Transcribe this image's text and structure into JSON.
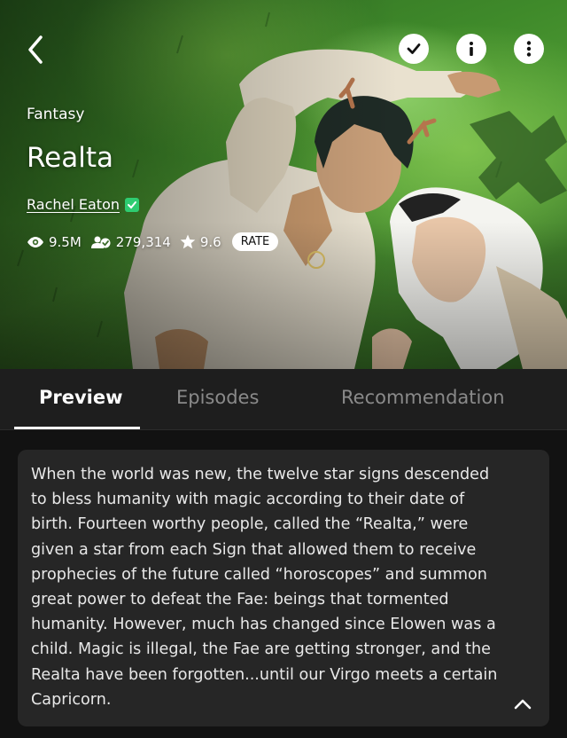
{
  "header": {
    "genre": "Fantasy",
    "title": "Realta",
    "author": "Rachel Eaton",
    "stats": {
      "views": "9.5M",
      "subscribers": "279,314",
      "rating": "9.6",
      "rate_label": "RATE"
    },
    "icons": {
      "back": "chevron-left-icon",
      "subscribe": "check-icon",
      "info": "info-icon",
      "more": "more-vertical-icon"
    }
  },
  "tabs": [
    {
      "label": "Preview",
      "active": true
    },
    {
      "label": "Episodes",
      "active": false
    },
    {
      "label": "Recommendation",
      "active": false
    }
  ],
  "description": "When the world was new, the twelve star signs descended to bless humanity with magic according to their date of birth. Fourteen worthy people, called the “Realta,” were given a star from each Sign that allowed them to receive prophecies of the future called “horoscopes” and summon great power to defeat the Fae: beings that tormented humanity. However, much has changed since Elowen was a child. Magic is illegal, the Fae are getting stronger, and the Realta have been forgotten...until our Virgo meets a certain Capricorn.",
  "colors": {
    "background": "#121212",
    "tab_bar": "#1e1e1e",
    "card": "#262626",
    "verified": "#2ecc71",
    "inactive_tab": "#8a8a8a"
  }
}
